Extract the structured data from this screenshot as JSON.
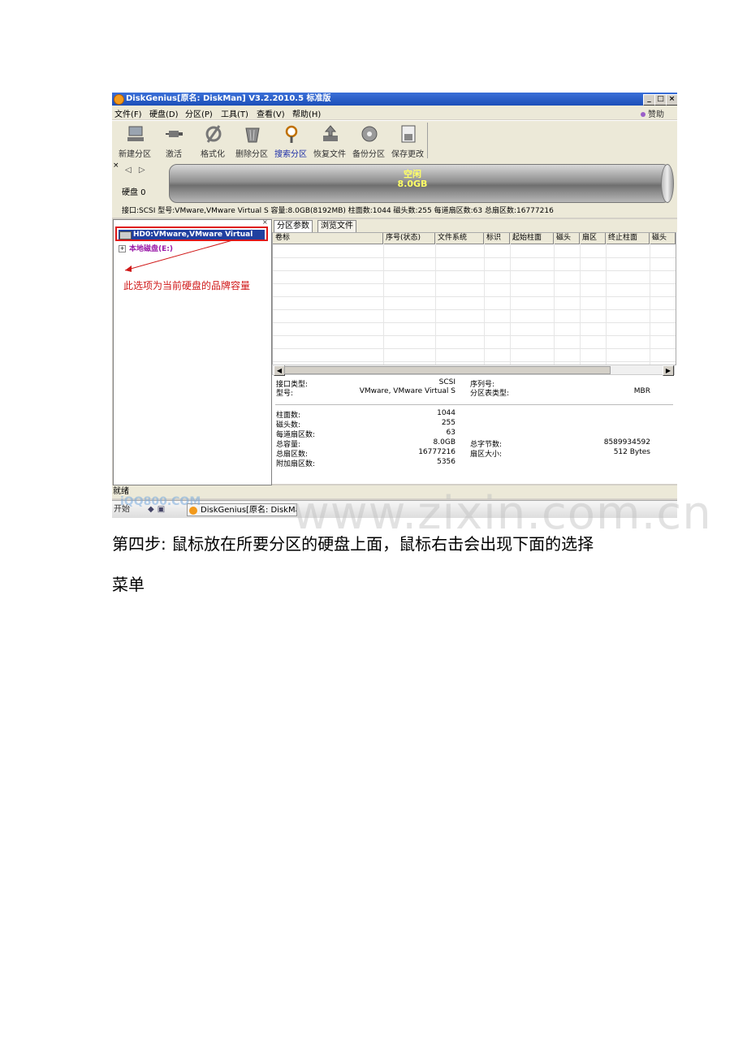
{
  "window": {
    "title": "DiskGenius[原名: DiskMan] V3.2.2010.5 标准版",
    "buttons": [
      "_",
      "□",
      "×"
    ]
  },
  "menu": {
    "items": [
      "文件(F)",
      "硬盘(D)",
      "分区(P)",
      "工具(T)",
      "查看(V)",
      "帮助(H)"
    ],
    "sponsor": "赞助"
  },
  "toolbar": {
    "items": [
      {
        "label": "新建分区",
        "icon": "new-partition-icon"
      },
      {
        "label": "激活",
        "icon": "activate-icon"
      },
      {
        "label": "格式化",
        "icon": "format-icon"
      },
      {
        "label": "删除分区",
        "icon": "delete-partition-icon"
      },
      {
        "label": "搜索分区",
        "icon": "search-partition-icon"
      },
      {
        "label": "恢复文件",
        "icon": "recover-files-icon"
      },
      {
        "label": "备份分区",
        "icon": "backup-partition-icon"
      },
      {
        "label": "保存更改",
        "icon": "save-changes-icon"
      }
    ]
  },
  "disk_bar": {
    "close": "×",
    "nav": "◁ ▷",
    "disk_label": "硬盘 0",
    "free_label": "空闲",
    "free_size": "8.0GB"
  },
  "info_line": "接口:SCSI  型号:VMware,VMware Virtual S  容量:8.0GB(8192MB)  柱面数:1044  磁头数:255  每道扇区数:63  总扇区数:16777216",
  "tree": {
    "close": "×",
    "hd0": "HD0:VMware,VMware Virtual",
    "local_disk": "本地磁盘(E:)",
    "expander": "+",
    "annotation": "此选项为当前硬盘的品牌容量"
  },
  "tabs": [
    "分区参数",
    "浏览文件"
  ],
  "table": {
    "headers": [
      "卷标",
      "序号(状态)",
      "文件系统",
      "标识",
      "起始柱面",
      "磁头",
      "扇区",
      "终止柱面",
      "磁头"
    ]
  },
  "details": {
    "left": [
      {
        "label": "接口类型:",
        "value": "SCSI"
      },
      {
        "label": "型号:",
        "value": "VMware, VMware Virtual S"
      },
      {
        "label": "柱面数:",
        "value": "1044"
      },
      {
        "label": "磁头数:",
        "value": "255"
      },
      {
        "label": "每道扇区数:",
        "value": "63"
      },
      {
        "label": "总容量:",
        "value": "8.0GB"
      },
      {
        "label": "总扇区数:",
        "value": "16777216"
      },
      {
        "label": "附加扇区数:",
        "value": "5356"
      }
    ],
    "right": [
      {
        "label": "序列号:",
        "value": ""
      },
      {
        "label": "分区表类型:",
        "value": "MBR"
      },
      {
        "label": "总字节数:",
        "value": "8589934592"
      },
      {
        "label": "扇区大小:",
        "value": "512 Bytes"
      }
    ]
  },
  "status": "就绪",
  "taskbar": {
    "start": "开始",
    "task": "DiskGenius[原名: DiskMa..."
  },
  "watermarks": {
    "small": "iQQ800.COM",
    "large": "www.zixin.com.cn"
  },
  "document": {
    "line1": "第四步: 鼠标放在所要分区的硬盘上面，鼠标右击会出现下面的选择",
    "line2": "菜单"
  }
}
